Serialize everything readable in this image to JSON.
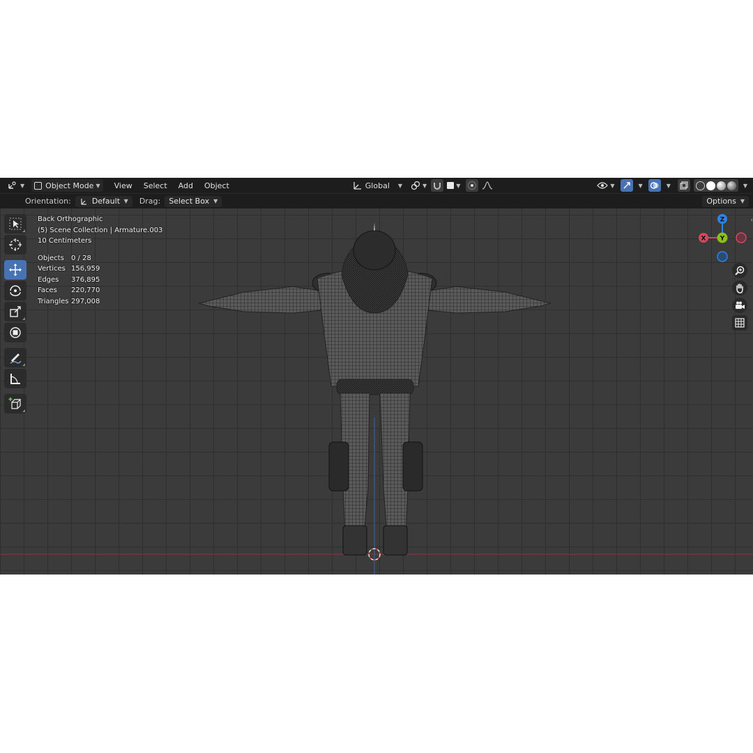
{
  "header": {
    "mode": "Object Mode",
    "menus": [
      "View",
      "Select",
      "Add",
      "Object"
    ],
    "transform_orientation": "Global"
  },
  "toolheader": {
    "orientation_label": "Orientation:",
    "orientation_value": "Default",
    "drag_label": "Drag:",
    "drag_value": "Select Box",
    "options_label": "Options"
  },
  "overlay": {
    "view_name": "Back Orthographic",
    "collection": "(5) Scene Collection | Armature.003",
    "scale": "10 Centimeters",
    "stats": [
      {
        "label": "Objects",
        "value": "0 / 28"
      },
      {
        "label": "Vertices",
        "value": "156,959"
      },
      {
        "label": "Edges",
        "value": "376,895"
      },
      {
        "label": "Faces",
        "value": "220,770"
      },
      {
        "label": "Triangles",
        "value": "297,008"
      }
    ]
  },
  "gizmo": {
    "z": "Z",
    "x": "X",
    "y": "Y"
  },
  "colors": {
    "header_bg": "#1d1d1d",
    "viewport_bg": "#3b3b3b",
    "active_blue": "#4772b3",
    "axis_x": "#d6465e",
    "axis_y": "#8cbf1c",
    "axis_z": "#2f83e6"
  }
}
